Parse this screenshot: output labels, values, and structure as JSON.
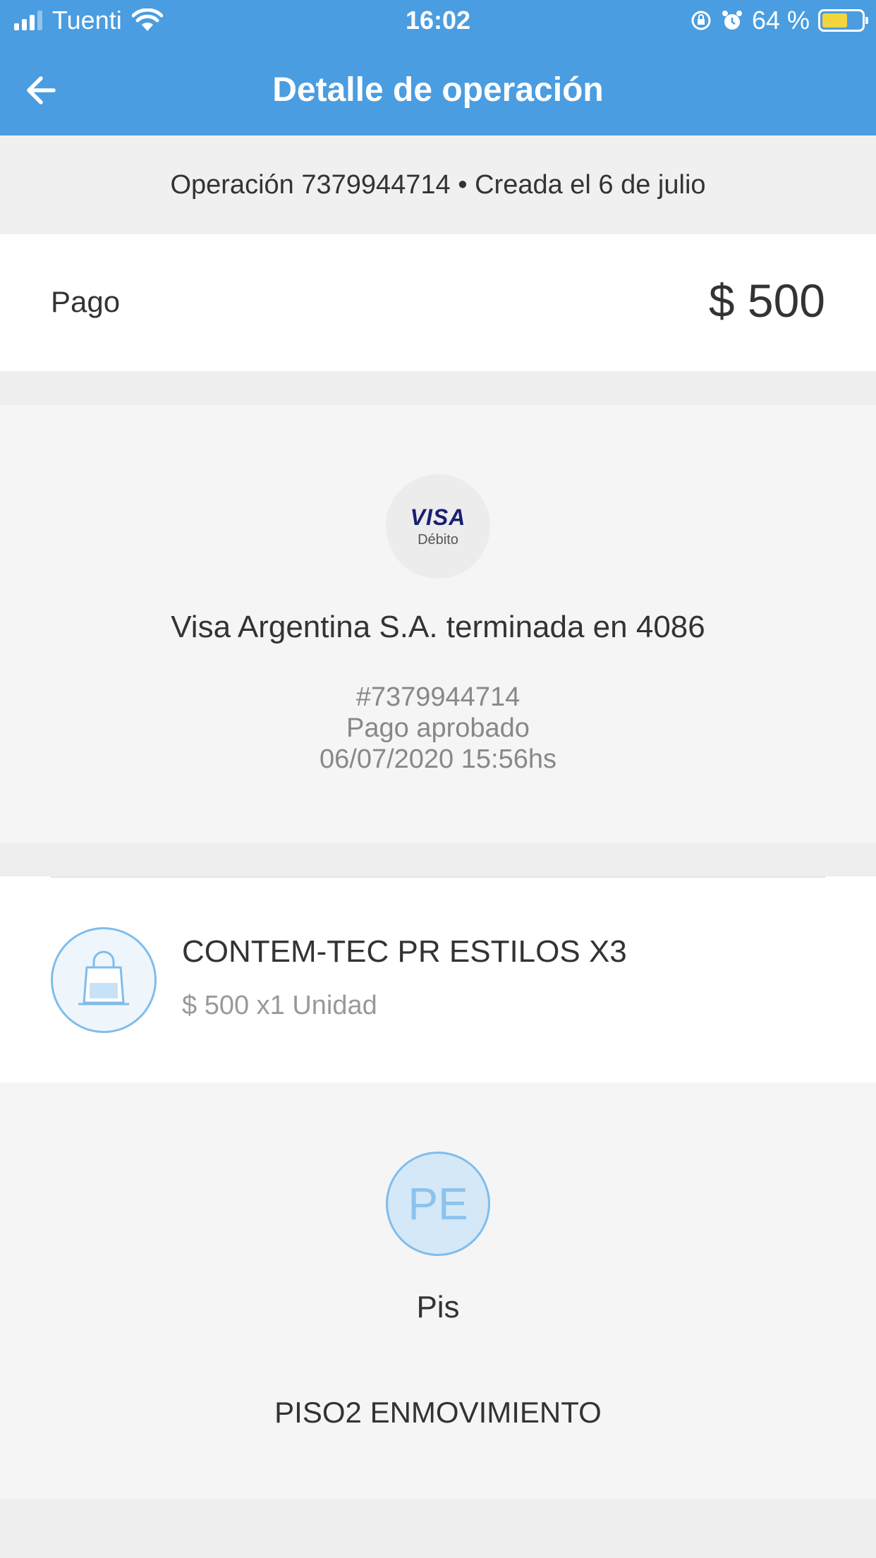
{
  "status_bar": {
    "carrier": "Tuenti",
    "time": "16:02",
    "battery_percent_label": "64 %",
    "battery_level": 0.64,
    "battery_color": "#f2d43c"
  },
  "app_bar": {
    "title": "Detalle de operación",
    "back_icon": "arrow-left-icon",
    "color": "#4a9de0"
  },
  "operation": {
    "header": "Operación 7379944714 • Creada el 6 de julio"
  },
  "payment": {
    "label": "Pago",
    "amount": "$ 500"
  },
  "card": {
    "brand": "VISA",
    "brand_sub": "Débito",
    "issuer": "Visa Argentina S.A. terminada en 4086",
    "reference": "#7379944714",
    "status": "Pago aprobado",
    "datetime": "06/07/2020 15:56hs"
  },
  "item": {
    "icon": "shopping-bag-icon",
    "name": "CONTEM-TEC PR ESTILOS X3",
    "price_line": "$ 500 x1 Unidad"
  },
  "seller": {
    "initials": "PE",
    "name": "Pis",
    "store": "PISO2 ENMOVIMIENTO"
  }
}
